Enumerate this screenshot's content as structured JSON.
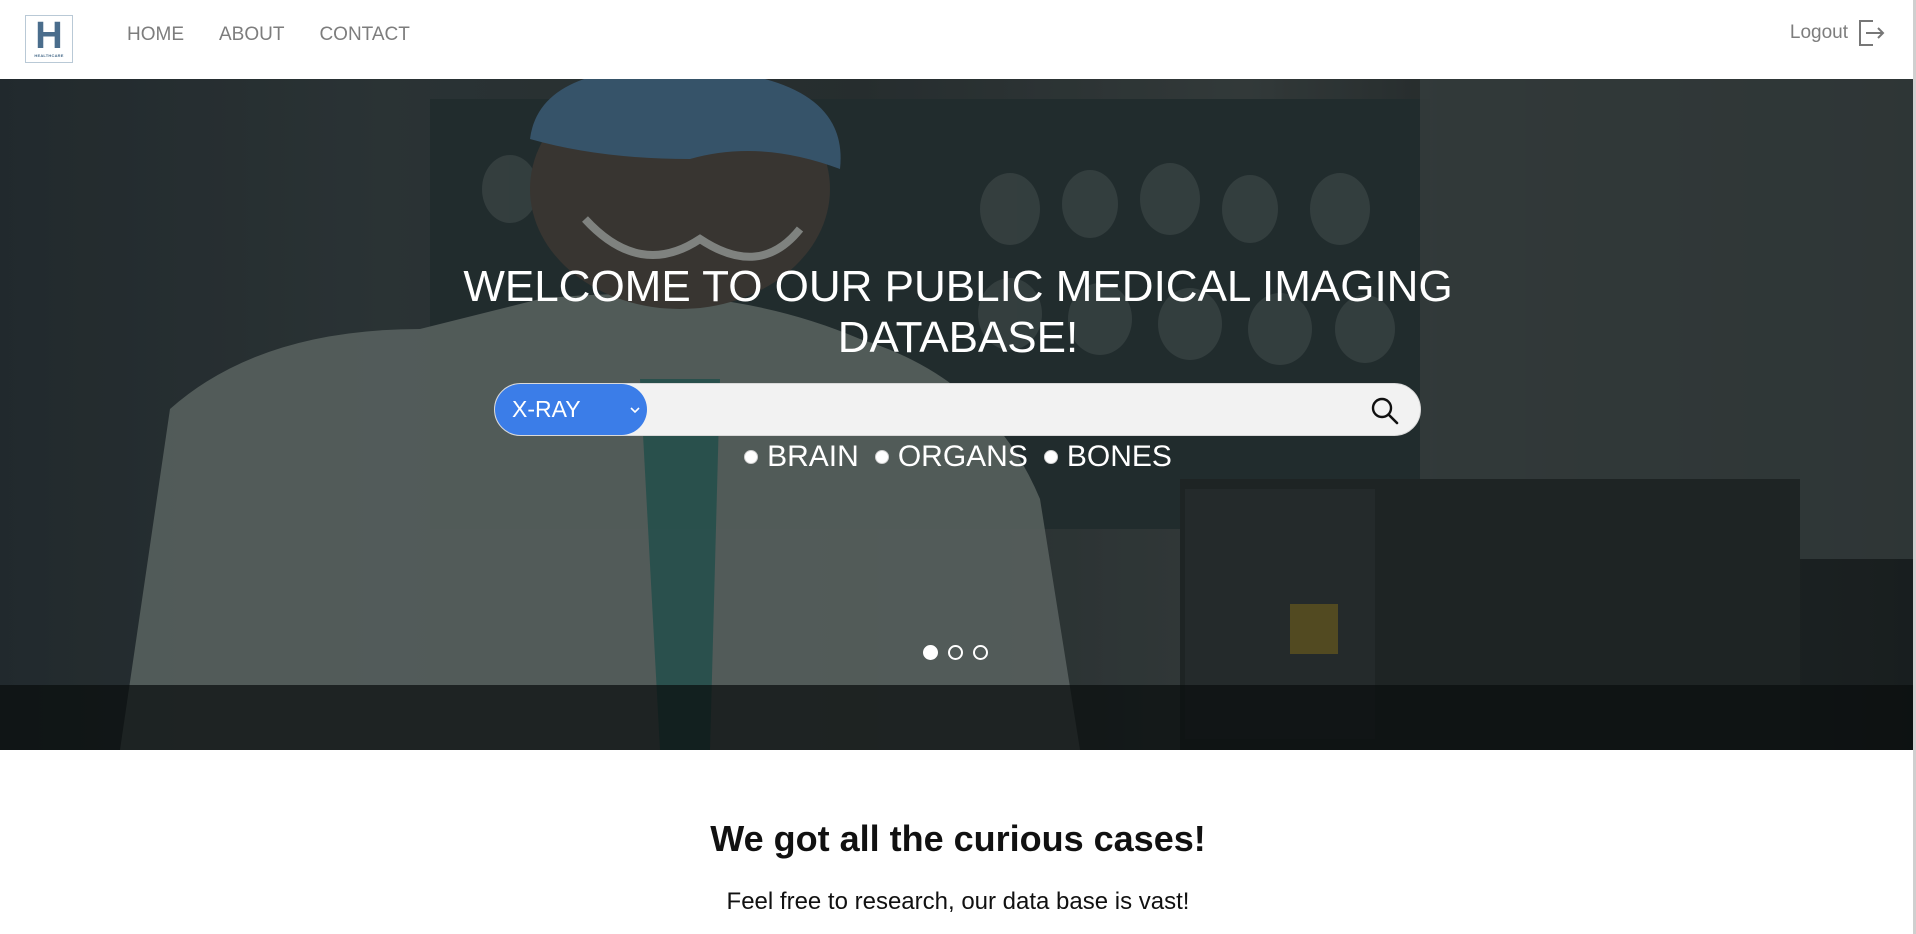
{
  "logo": {
    "letter": "H",
    "caption": "HEALTHCARE"
  },
  "nav": {
    "links": [
      {
        "label": "HOME"
      },
      {
        "label": "ABOUT"
      },
      {
        "label": "CONTACT"
      }
    ],
    "logout_label": "Logout",
    "logout_icon": "logout-icon"
  },
  "hero": {
    "title": "WELCOME TO OUR PUBLIC MEDICAL IMAGING DATABASE!",
    "search": {
      "selected_type": "X-RAY",
      "placeholder": "",
      "value": "",
      "select_icon": "chevron-down-icon",
      "search_icon": "search-icon",
      "accent_color": "#3b7de8"
    },
    "categories": [
      {
        "label": "BRAIN"
      },
      {
        "label": "ORGANS"
      },
      {
        "label": "BONES"
      }
    ],
    "carousel": {
      "slide_count": 3,
      "active_slide": 1
    }
  },
  "intro": {
    "title": "We got all the curious cases!",
    "text": "Feel free to research, our data base is vast!"
  }
}
